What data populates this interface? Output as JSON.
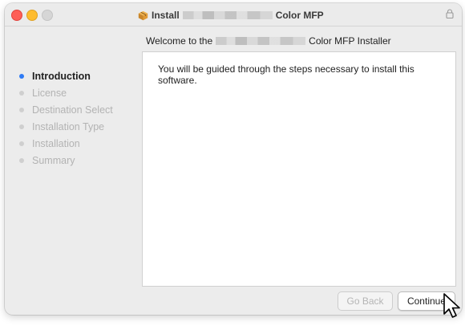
{
  "window": {
    "title_prefix": "Install",
    "title_suffix": "Color MFP"
  },
  "header": {
    "prefix": "Welcome to the",
    "suffix": "Color MFP Installer"
  },
  "sidebar": {
    "steps": [
      {
        "label": "Introduction",
        "active": true
      },
      {
        "label": "License",
        "active": false
      },
      {
        "label": "Destination Select",
        "active": false
      },
      {
        "label": "Installation Type",
        "active": false
      },
      {
        "label": "Installation",
        "active": false
      },
      {
        "label": "Summary",
        "active": false
      }
    ]
  },
  "content": {
    "text": "You will be guided through the steps necessary to install this software."
  },
  "buttons": {
    "go_back": "Go Back",
    "continue": "Continue"
  },
  "colors": {
    "accent": "#2f7bf5",
    "close": "#fe5f57",
    "minimize": "#febc2e"
  },
  "icons": {
    "title": "package-icon",
    "lock": "lock-icon",
    "cursor": "arrow-cursor-icon"
  }
}
